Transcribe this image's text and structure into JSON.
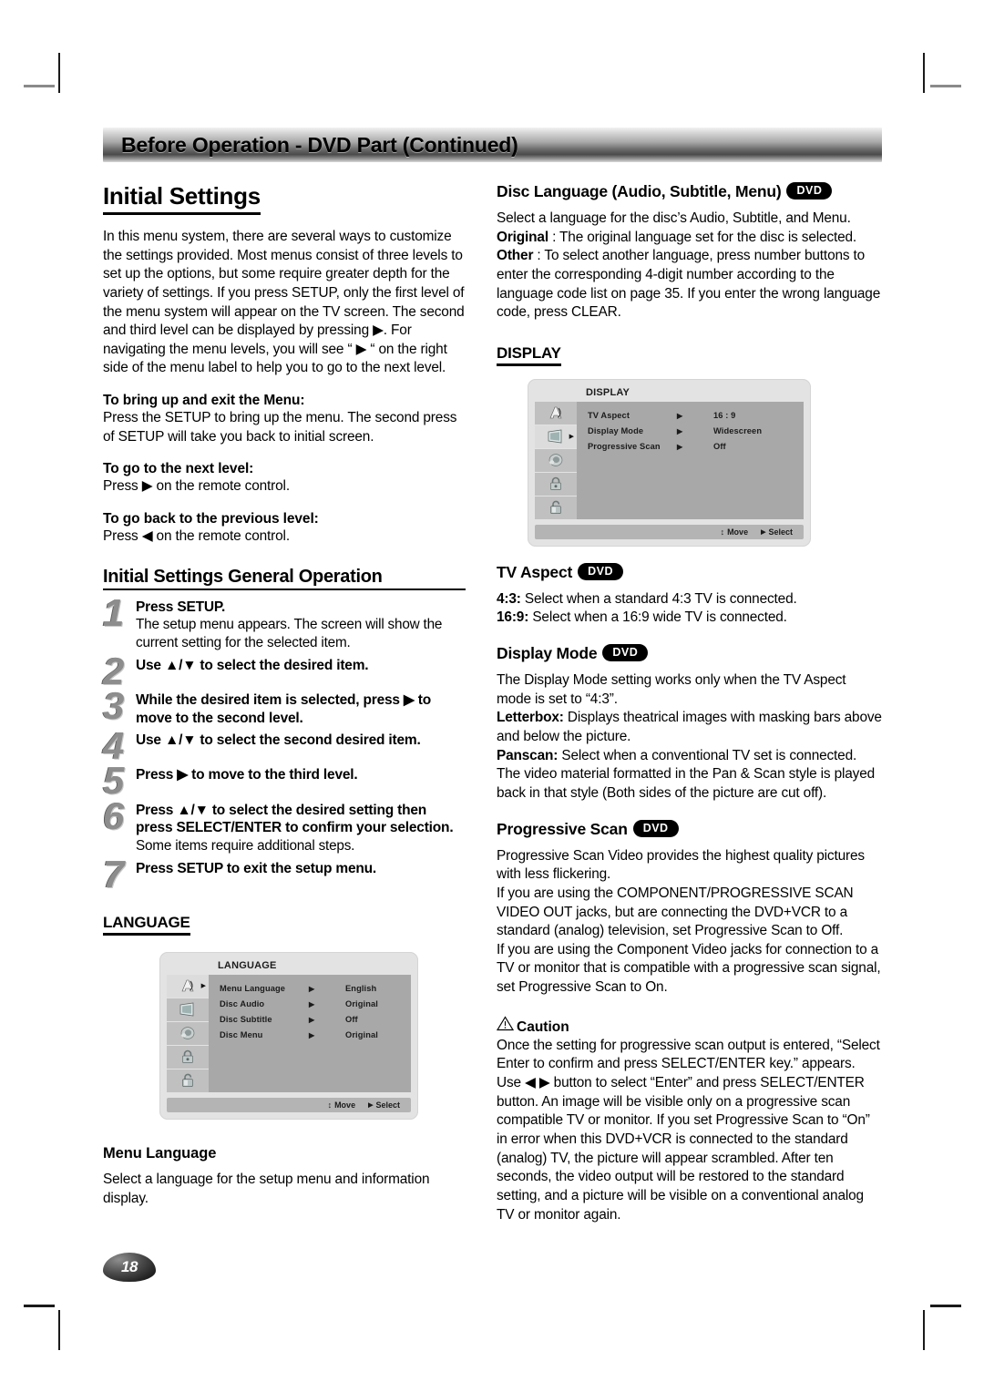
{
  "banner": {
    "title": "Before Operation - DVD Part (Continued)"
  },
  "page_number": "18",
  "left": {
    "section_title": "Initial Settings",
    "intro": "In this menu system, there are several ways to customize the settings provided. Most menus consist of three levels to set up the options, but some require greater depth for the variety of settings. If you press SETUP, only the first level of the menu system will appear on the TV screen. The second and third level can be displayed by pressing ▶. For navigating the menu levels, you will see “ ▶ “ on the right side of the menu label to help you to go to the next level.",
    "bring_up_heading": "To bring up and exit the Menu:",
    "bring_up_text": "Press the SETUP to bring up the menu. The second press of SETUP will take you back to initial screen.",
    "next_level_heading": "To go to the next level:",
    "next_level_text": "Press ▶ on the remote control.",
    "prev_level_heading": "To go back to the previous level:",
    "prev_level_text": "Press ◀ on the remote control.",
    "general_op_title": "Initial Settings General Operation",
    "steps": [
      {
        "num": "1",
        "title": "Press SETUP.",
        "desc": "The setup menu appears. The screen will show the current setting for the selected item."
      },
      {
        "num": "2",
        "title": "Use ▲/▼ to select the desired item.",
        "desc": ""
      },
      {
        "num": "3",
        "title": "While the desired item is selected, press ▶ to move to the second level.",
        "desc": ""
      },
      {
        "num": "4",
        "title": "Use ▲/▼ to select the second desired item.",
        "desc": ""
      },
      {
        "num": "5",
        "title": "Press ▶ to move to the third level.",
        "desc": ""
      },
      {
        "num": "6",
        "title": "Press ▲/▼ to select the desired setting then press SELECT/ENTER to confirm your selection.",
        "desc": "Some items require additional steps."
      },
      {
        "num": "7",
        "title": "Press SETUP to exit the setup menu.",
        "desc": ""
      }
    ],
    "language_heading": "LANGUAGE",
    "language_menu": {
      "title": "LANGUAGE",
      "rows": [
        {
          "label": "Menu Language",
          "arrow": "▶",
          "value": "English"
        },
        {
          "label": "Disc Audio",
          "arrow": "▶",
          "value": "Original"
        },
        {
          "label": "Disc Subtitle",
          "arrow": "▶",
          "value": "Off"
        },
        {
          "label": "Disc Menu",
          "arrow": "▶",
          "value": "Original"
        }
      ],
      "footer_move": "Move",
      "footer_select": "Select",
      "selected_icon_index": 0,
      "icons": [
        "language-icon",
        "display-icon",
        "audio-icon",
        "lock-icon",
        "others-icon"
      ]
    },
    "menu_language_heading": "Menu Language",
    "menu_language_text": "Select a language for the setup menu and information display."
  },
  "right": {
    "disc_language_heading": "Disc Language (Audio, Subtitle, Menu)",
    "disc_language_badge": "DVD",
    "disc_language_intro": "Select a language for the disc’s Audio, Subtitle, and Menu.",
    "disc_language_original_label": "Original",
    "disc_language_original_text": " : The original language set for the disc is selected.",
    "disc_language_other_label": "Other",
    "disc_language_other_text": " : To select another language, press number buttons to enter the corresponding 4-digit number according to the language code list on page 35. If you enter the wrong language code, press CLEAR.",
    "display_heading": "DISPLAY",
    "display_menu": {
      "title": "DISPLAY",
      "rows": [
        {
          "label": "TV Aspect",
          "arrow": "▶",
          "value": "16 : 9"
        },
        {
          "label": "Display Mode",
          "arrow": "▶",
          "value": "Widescreen"
        },
        {
          "label": "Progressive Scan",
          "arrow": "▶",
          "value": "Off"
        }
      ],
      "footer_move": "Move",
      "footer_select": "Select",
      "selected_icon_index": 1,
      "icons": [
        "language-icon",
        "display-icon",
        "audio-icon",
        "lock-icon",
        "others-icon"
      ]
    },
    "tv_aspect_heading": "TV Aspect",
    "tv_aspect_badge": "DVD",
    "tv_aspect_43_label": "4:3:",
    "tv_aspect_43_text": " Select when a standard 4:3 TV is connected.",
    "tv_aspect_169_label": "16:9:",
    "tv_aspect_169_text": " Select when a 16:9 wide TV is connected.",
    "display_mode_heading": "Display Mode",
    "display_mode_badge": "DVD",
    "display_mode_intro": "The Display Mode setting works only when the TV Aspect mode is set to “4:3”.",
    "display_mode_letterbox_label": "Letterbox:",
    "display_mode_letterbox_text": " Displays theatrical images with masking bars above and below the picture.",
    "display_mode_panscan_label": "Panscan:",
    "display_mode_panscan_text": " Select when a conventional TV set is connected. The video material formatted in the Pan & Scan style is played back in that style (Both sides of the picture are cut off).",
    "progressive_scan_heading": "Progressive Scan",
    "progressive_scan_badge": "DVD",
    "progressive_scan_text": "Progressive Scan Video provides the highest quality pictures with less flickering.\nIf you are using the COMPONENT/PROGRESSIVE SCAN VIDEO OUT jacks, but are connecting the DVD+VCR to a standard (analog) television, set Progressive Scan to Off.\nIf you are using the Component Video jacks for connection to a TV or monitor that is compatible with a progressive scan signal, set Progressive Scan to On.",
    "caution_heading": "Caution",
    "caution_text": "Once the setting for progressive scan output is entered, “Select Enter to confirm and press SELECT/ENTER key.” appears. Use ◀ ▶ button to select “Enter” and press SELECT/ENTER button. An image will be visible only on a progressive scan compatible TV or monitor. If you set Progressive Scan to “On” in error when this DVD+VCR is connected to the standard (analog) TV, the picture will appear scrambled. After ten seconds, the video output will be restored to the standard setting, and a picture will be visible on a conventional analog TV or monitor again."
  }
}
